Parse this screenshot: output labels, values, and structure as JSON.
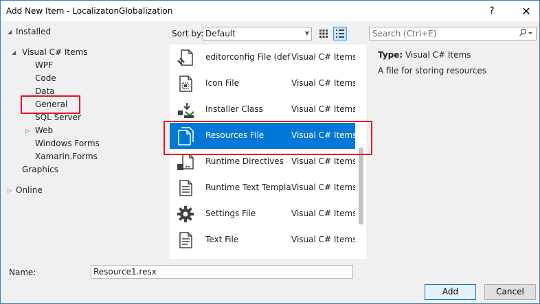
{
  "window": {
    "title": "Add New Item - LocalizatonGlobalization",
    "help": "?",
    "close": "✕"
  },
  "tree": {
    "installed": "Installed",
    "visual_csharp": "Visual C# Items",
    "children": [
      "WPF",
      "Code",
      "Data",
      "General",
      "SQL Server",
      "Web",
      "Windows Forms",
      "Xamarin.Forms"
    ],
    "graphics": "Graphics",
    "online": "Online"
  },
  "toolbar": {
    "sort_label": "Sort by:",
    "sort_value": "Default",
    "search_placeholder": "Search (Ctrl+E)"
  },
  "items": [
    {
      "name": "editorconfig File (defa...",
      "category": "Visual C# Items",
      "icon": "editorconfig-icon"
    },
    {
      "name": "Icon File",
      "category": "Visual C# Items",
      "icon": "icon-file-icon"
    },
    {
      "name": "Installer Class",
      "category": "Visual C# Items",
      "icon": "installer-class-icon"
    },
    {
      "name": "Resources File",
      "category": "Visual C# Items",
      "icon": "resources-file-icon",
      "selected": true
    },
    {
      "name": "Runtime Directives",
      "category": "Visual C# Items",
      "icon": "runtime-directives-icon"
    },
    {
      "name": "Runtime Text Template",
      "category": "Visual C# Items",
      "icon": "text-template-icon"
    },
    {
      "name": "Settings File",
      "category": "Visual C# Items",
      "icon": "settings-gear-icon"
    },
    {
      "name": "Text File",
      "category": "Visual C# Items",
      "icon": "text-file-icon"
    }
  ],
  "details": {
    "type_label": "Type:",
    "type_value": "Visual C# Items",
    "description": "A file for storing resources"
  },
  "footer": {
    "name_label": "Name:",
    "name_value": "Resource1.resx",
    "add_label": "Add",
    "cancel_label": "Cancel"
  },
  "colors": {
    "accent": "#0078d7",
    "highlight_box": "#e81123"
  }
}
